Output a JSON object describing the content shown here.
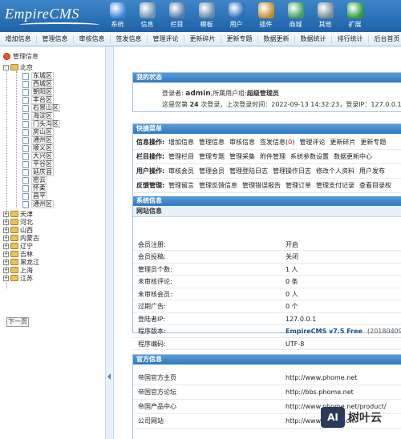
{
  "header": {
    "logo_text": "EmpireCMS",
    "nav": [
      {
        "label": "系统",
        "icon": "globe-icon",
        "color": "#3a80d9"
      },
      {
        "label": "信息",
        "icon": "document-pen-icon",
        "color": "#6b8fb0"
      },
      {
        "label": "栏目",
        "icon": "folder-icon",
        "color": "#4e7aa5"
      },
      {
        "label": "模板",
        "icon": "monitor-icon",
        "color": "#5e88a8"
      },
      {
        "label": "用户",
        "icon": "user-icon",
        "color": "#2a6db5"
      },
      {
        "label": "插件",
        "icon": "tools-icon",
        "color": "#c08a2a"
      },
      {
        "label": "商城",
        "icon": "card-icon",
        "color": "#3d9c5e"
      },
      {
        "label": "其他",
        "icon": "gear-icon",
        "color": "#7a8a98"
      },
      {
        "label": "扩展",
        "icon": "plus-circle-icon",
        "color": "#2f9a3c"
      }
    ]
  },
  "menubar": [
    "增加信息",
    "管理信息",
    "审核信息",
    "签发信息",
    "管理评论",
    "更新碎片",
    "更新专题",
    "数据更新",
    "数据统计",
    "排行统计",
    "后台首页"
  ],
  "sidebar": {
    "root_label": "管理信息",
    "beijing": {
      "label": "北京",
      "children": [
        "东城区",
        "西城区",
        "朝阳区",
        "丰台区",
        "石景山区",
        "海淀区",
        "门头沟区",
        "房山区",
        "通州区",
        "顺义区",
        "大兴区",
        "平谷区",
        "延庆县",
        "密云",
        "怀柔",
        "昌平",
        "通州区"
      ]
    },
    "provinces": [
      "天津",
      "河北",
      "山西",
      "内蒙古",
      "辽宁",
      "吉林",
      "黑龙江",
      "上海",
      "江苏"
    ],
    "prev_page": "下一页"
  },
  "status": {
    "title": "我的状态",
    "line1_prefix": "登录者:",
    "user": "admin",
    "line1_mid": ",所属用户组:",
    "group": "超级管理员",
    "line2_a": "这是您第",
    "login_count": "24",
    "line2_b": "次登录，上次登录时间：",
    "last_time": "2022-09-13 14:32:23",
    "line2_c": "，登录IP：",
    "last_ip": "127.0.0.1"
  },
  "quick": {
    "title": "快捷菜单",
    "rows": [
      {
        "label": "信息操作:",
        "links": [
          "增加信息",
          "管理信息",
          "审核信息",
          "签发信息(0)",
          "管理评论",
          "更新碎片",
          "更新专题"
        ]
      },
      {
        "label": "栏目操作:",
        "links": [
          "管理栏目",
          "管理专题",
          "管理采集",
          "附件管理",
          "系统参数设置",
          "数据更新中心"
        ]
      },
      {
        "label": "用户操作:",
        "links": [
          "审核会员",
          "管理会员",
          "管理登陆日志",
          "管理操作日志",
          "修改个人资料",
          "用户发布"
        ]
      },
      {
        "label": "反馈管理:",
        "links": [
          "管理留言",
          "管理反馈信息",
          "管理错误报告",
          "管理订单",
          "管理支付记录",
          "查看目录权"
        ]
      }
    ]
  },
  "sysinfo": {
    "title": "系统信息",
    "sub": "网站信息",
    "rows": [
      {
        "k": "会员注册:",
        "v": "开启"
      },
      {
        "k": "会员投稿:",
        "v": "关闭"
      },
      {
        "k": "管理员个数:",
        "v": "1 人"
      },
      {
        "k": "未审核评论:",
        "v": "0 条"
      },
      {
        "k": "未审核会员:",
        "v": "0 人"
      },
      {
        "k": "过期广告:",
        "v": "0 个"
      },
      {
        "k": "登陆者IP:",
        "v": "127.0.0.1"
      },
      {
        "k": "程序版本:",
        "v": "EmpireCMS v7.5 Free",
        "extra": "(20180409103"
      },
      {
        "k": "程序编码:",
        "v": "UTF-8"
      }
    ]
  },
  "official": {
    "title": "官方信息",
    "rows": [
      {
        "k": "帝国官方主页",
        "v": "http://www.phome.net"
      },
      {
        "k": "帝国官方论坛",
        "v": "http://bbs.phome.net"
      },
      {
        "k": "帝国产品中心",
        "v": "http://www.phome.net/product/"
      },
      {
        "k": "公司网站",
        "v": "http://www.digod.com"
      }
    ]
  },
  "watermark": {
    "text": "树叶云",
    "badge": "AI"
  },
  "colors": {
    "accent": "#2f78c0",
    "warn": "#d00000"
  }
}
